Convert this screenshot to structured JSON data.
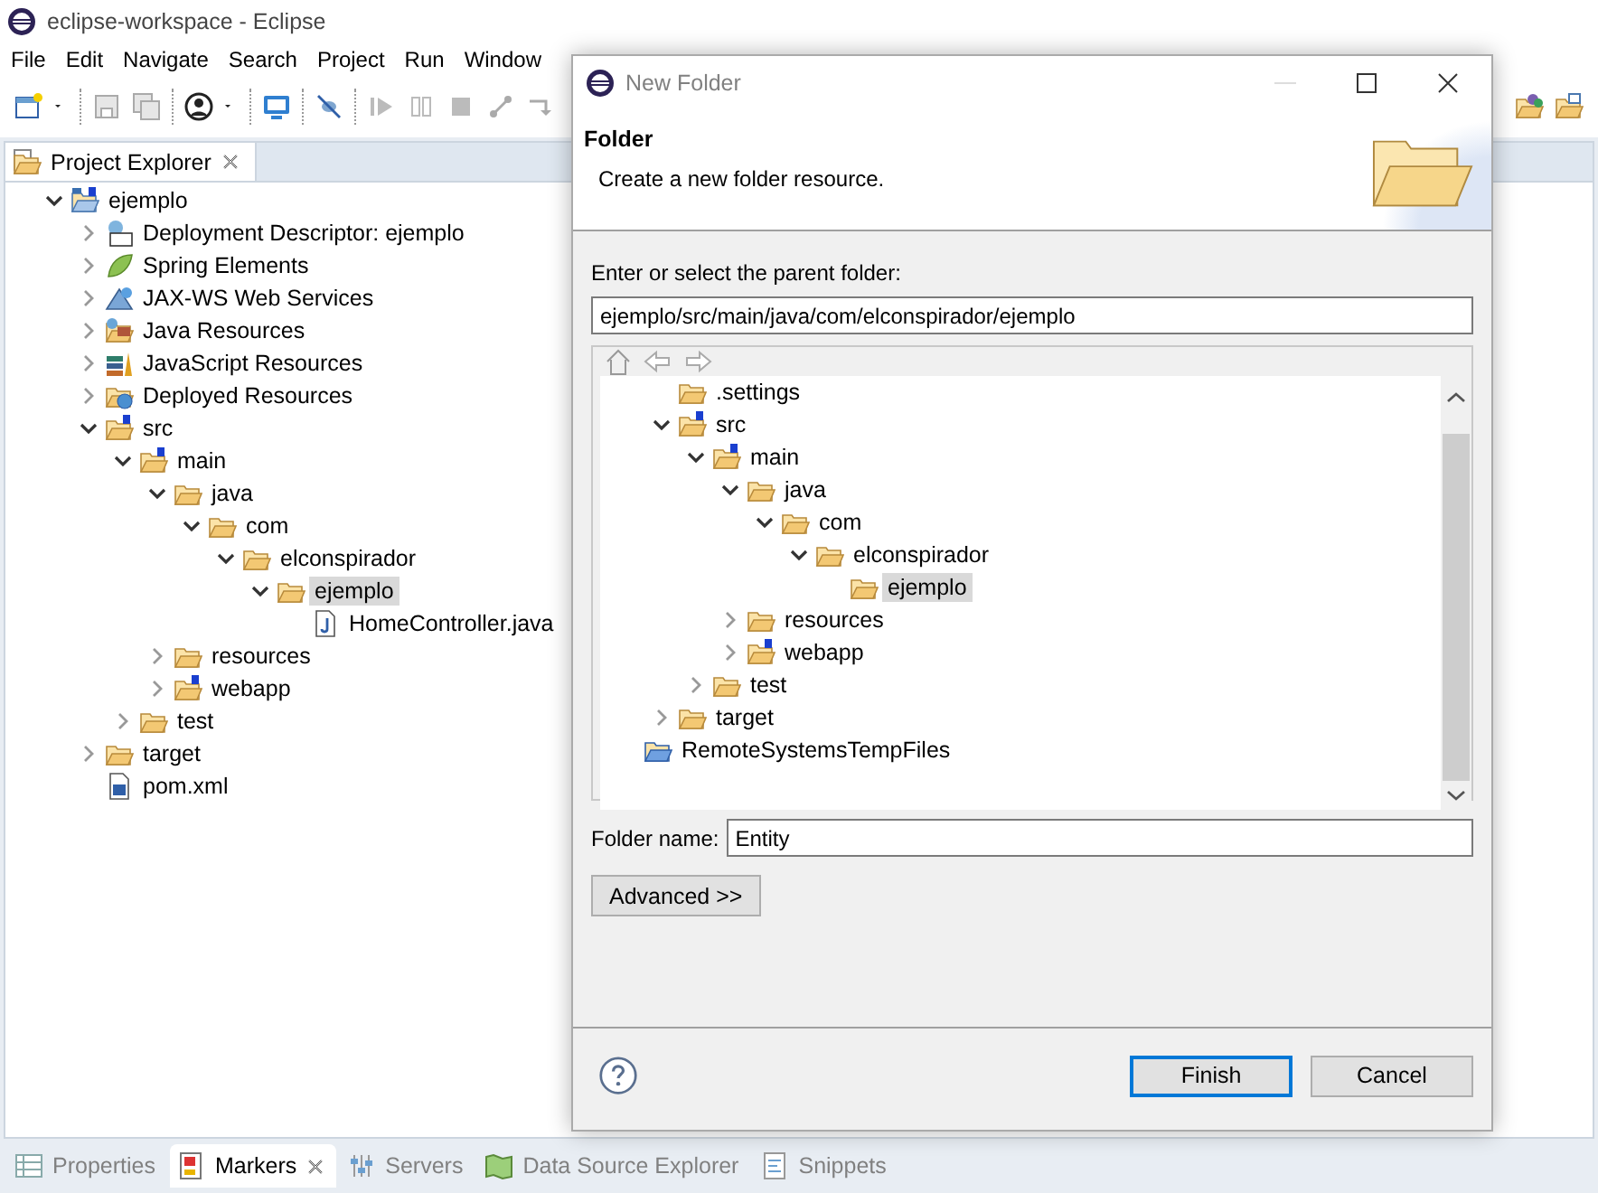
{
  "window": {
    "title": "eclipse-workspace - Eclipse"
  },
  "menu": [
    "File",
    "Edit",
    "Navigate",
    "Search",
    "Project",
    "Run",
    "Window"
  ],
  "explorer": {
    "tab": "Project Explorer",
    "tree": [
      {
        "label": "ejemplo",
        "kind": "project",
        "expanded": true,
        "selected": false,
        "children": [
          {
            "label": "Deployment Descriptor: ejemplo",
            "kind": "descriptor",
            "expanded": false,
            "selected": false
          },
          {
            "label": "Spring Elements",
            "kind": "spring",
            "expanded": false,
            "selected": false
          },
          {
            "label": "JAX-WS Web Services",
            "kind": "webservice",
            "expanded": false,
            "selected": false
          },
          {
            "label": "Java Resources",
            "kind": "javares",
            "expanded": false,
            "selected": false
          },
          {
            "label": "JavaScript Resources",
            "kind": "jsres",
            "expanded": false,
            "selected": false
          },
          {
            "label": "Deployed Resources",
            "kind": "deployed",
            "expanded": false,
            "selected": false
          },
          {
            "label": "src",
            "kind": "source-folder",
            "expanded": true,
            "selected": false,
            "children": [
              {
                "label": "main",
                "kind": "source-folder",
                "expanded": true,
                "selected": false,
                "children": [
                  {
                    "label": "java",
                    "kind": "folder",
                    "expanded": true,
                    "selected": false,
                    "children": [
                      {
                        "label": "com",
                        "kind": "folder",
                        "expanded": true,
                        "selected": false,
                        "children": [
                          {
                            "label": "elconspirador",
                            "kind": "folder",
                            "expanded": true,
                            "selected": false,
                            "children": [
                              {
                                "label": "ejemplo",
                                "kind": "folder",
                                "expanded": true,
                                "selected": true,
                                "children": [
                                  {
                                    "label": "HomeController.java",
                                    "kind": "java",
                                    "selected": false
                                  }
                                ]
                              }
                            ]
                          }
                        ]
                      }
                    ]
                  },
                  {
                    "label": "resources",
                    "kind": "folder",
                    "expanded": false,
                    "selected": false
                  },
                  {
                    "label": "webapp",
                    "kind": "source-folder",
                    "expanded": false,
                    "selected": false
                  }
                ]
              },
              {
                "label": "test",
                "kind": "folder",
                "expanded": false,
                "selected": false
              }
            ]
          },
          {
            "label": "target",
            "kind": "folder",
            "expanded": false,
            "selected": false
          },
          {
            "label": "pom.xml",
            "kind": "maven",
            "selected": false
          }
        ]
      }
    ]
  },
  "bottom_tabs": [
    {
      "label": "Properties",
      "kind": "properties",
      "selected": false
    },
    {
      "label": "Markers",
      "kind": "markers",
      "selected": true
    },
    {
      "label": "Servers",
      "kind": "servers",
      "selected": false
    },
    {
      "label": "Data Source Explorer",
      "kind": "datasource",
      "selected": false
    },
    {
      "label": "Snippets",
      "kind": "snippets",
      "selected": false
    }
  ],
  "dialog": {
    "title": "New Folder",
    "heading": "Folder",
    "description": "Create a new folder resource.",
    "parent_label": "Enter or select the parent folder:",
    "parent_value": "ejemplo/src/main/java/com/elconspirador/ejemplo",
    "tree": [
      {
        "label": ".settings",
        "kind": "folder",
        "selected": false
      },
      {
        "label": "src",
        "kind": "source-folder",
        "expanded": true,
        "selected": false,
        "children": [
          {
            "label": "main",
            "kind": "source-folder",
            "expanded": true,
            "selected": false,
            "children": [
              {
                "label": "java",
                "kind": "folder",
                "expanded": true,
                "selected": false,
                "children": [
                  {
                    "label": "com",
                    "kind": "folder",
                    "expanded": true,
                    "selected": false,
                    "children": [
                      {
                        "label": "elconspirador",
                        "kind": "folder",
                        "expanded": true,
                        "selected": false,
                        "children": [
                          {
                            "label": "ejemplo",
                            "kind": "folder",
                            "selected": true
                          }
                        ]
                      }
                    ]
                  }
                ]
              },
              {
                "label": "resources",
                "kind": "folder",
                "expanded": false,
                "selected": false
              },
              {
                "label": "webapp",
                "kind": "source-folder",
                "expanded": false,
                "selected": false
              }
            ]
          },
          {
            "label": "test",
            "kind": "folder",
            "expanded": false,
            "selected": false
          }
        ]
      },
      {
        "label": "target",
        "kind": "folder",
        "expanded": false,
        "selected": false
      },
      {
        "label": "RemoteSystemsTempFiles",
        "kind": "closed-project",
        "selected": false
      }
    ],
    "name_label": "Folder name:",
    "name_value": "Entity",
    "buttons": [
      {
        "label": "Advanced >>",
        "kind": "advanced"
      },
      {
        "label": "Finish",
        "kind": "default"
      },
      {
        "label": "Cancel",
        "kind": "normal"
      }
    ]
  }
}
